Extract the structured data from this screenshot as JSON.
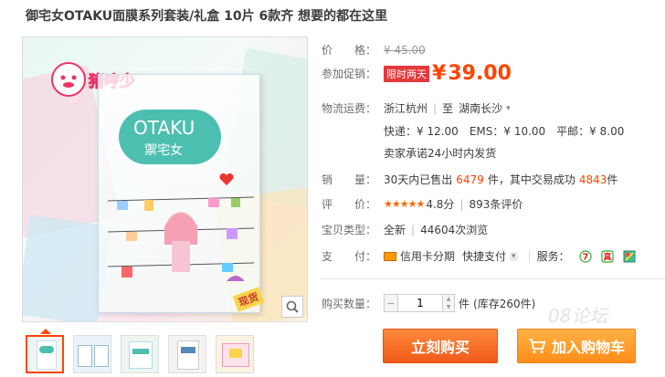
{
  "title": "御宅女OTAKU面膜系列套装/礼盒 10片 6款齐 想要的都在这里",
  "gallery": {
    "brand_text": "OTAKU",
    "brand_sub": "禦宅女",
    "logo_text": "猪哼少",
    "badge_text": "现货"
  },
  "price": {
    "label": "价　　格：",
    "original": "¥ 45.00"
  },
  "promo": {
    "label": "参加促销：",
    "badge": "限时两天",
    "currency": "¥",
    "price": "39.00"
  },
  "shipping": {
    "label": "物流运费：",
    "from": "浙江杭州",
    "to_prefix": "至",
    "to": "湖南长沙",
    "express": "快递：¥ 12.00",
    "ems": "EMS：¥ 10.00",
    "mail": "平邮：¥ 8.00",
    "promise": "卖家承诺24小时内发货"
  },
  "sales": {
    "label": "销　　量：",
    "prefix": "30天内已售出",
    "count": "6479",
    "middle": "件，其中交易成功",
    "success": "4843",
    "suffix": "件"
  },
  "rating": {
    "label": "评　　价：",
    "stars": "★★★★★",
    "score": "4.8分",
    "reviews": "893条评价"
  },
  "type": {
    "label": "宝贝类型：",
    "value": "全新",
    "views": "44604次浏览"
  },
  "payment": {
    "label": "支　　付：",
    "credit": "信用卡分期",
    "quick": "快捷支付",
    "service_label": "服务："
  },
  "quantity": {
    "label": "购买数量：",
    "value": "1",
    "unit": "件",
    "stock": "(库存260件)"
  },
  "buttons": {
    "buy": "立刻购买",
    "cart": "加入购物车"
  },
  "watermark": "08论坛",
  "colors": {
    "accent": "#ff4400",
    "buy_button": "#f05a1a",
    "cart_button": "#ff8d1a"
  }
}
